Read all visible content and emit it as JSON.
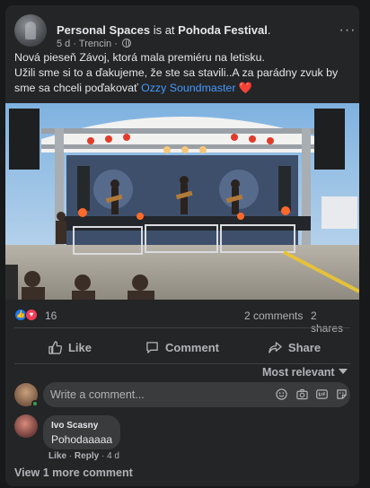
{
  "post": {
    "page_name": "Personal Spaces",
    "at_text": "is at",
    "location": "Pohoda Festival",
    "period": ".",
    "time": "5 d",
    "place": "Trencin",
    "sep": "·",
    "more_label": "···",
    "text_line1": "Nová pieseň Závoj, ktorá mala premiéru na letisku.",
    "text_line2": "Užili sme si to a ďakujeme, že ste sa stavili..A za parádny zvuk by",
    "text_line3_prefix": "sme sa chceli poďakovať",
    "mention": "Ozzy Soundmaster",
    "heart_emoji": "❤️",
    "reactions_count": "16",
    "comments_count": "2 comments",
    "shares_count": "2 shares"
  },
  "actions": {
    "like": "Like",
    "comment": "Comment",
    "share": "Share"
  },
  "comments": {
    "sort_label": "Most relevant",
    "input_placeholder": "Write a comment...",
    "items": [
      {
        "author": "Ivo Scasny",
        "text": "Pohodaaaaa",
        "like": "Like",
        "reply": "Reply",
        "time": "4 d",
        "dot": "·"
      }
    ],
    "view_more": "View 1 more comment"
  },
  "icons": {
    "globe": "globe-icon",
    "like": "thumbs-up-icon",
    "love": "heart-icon",
    "comment": "speech-bubble-icon",
    "share": "share-arrow-icon",
    "emoji": "smiley-icon",
    "camera": "camera-icon",
    "gif": "gif-icon",
    "sticker": "sticker-icon"
  },
  "colors": {
    "background": "#18191a",
    "card": "#242526",
    "link": "#4599ff",
    "like_blue": "#1877f2",
    "love_red": "#f33e58"
  }
}
